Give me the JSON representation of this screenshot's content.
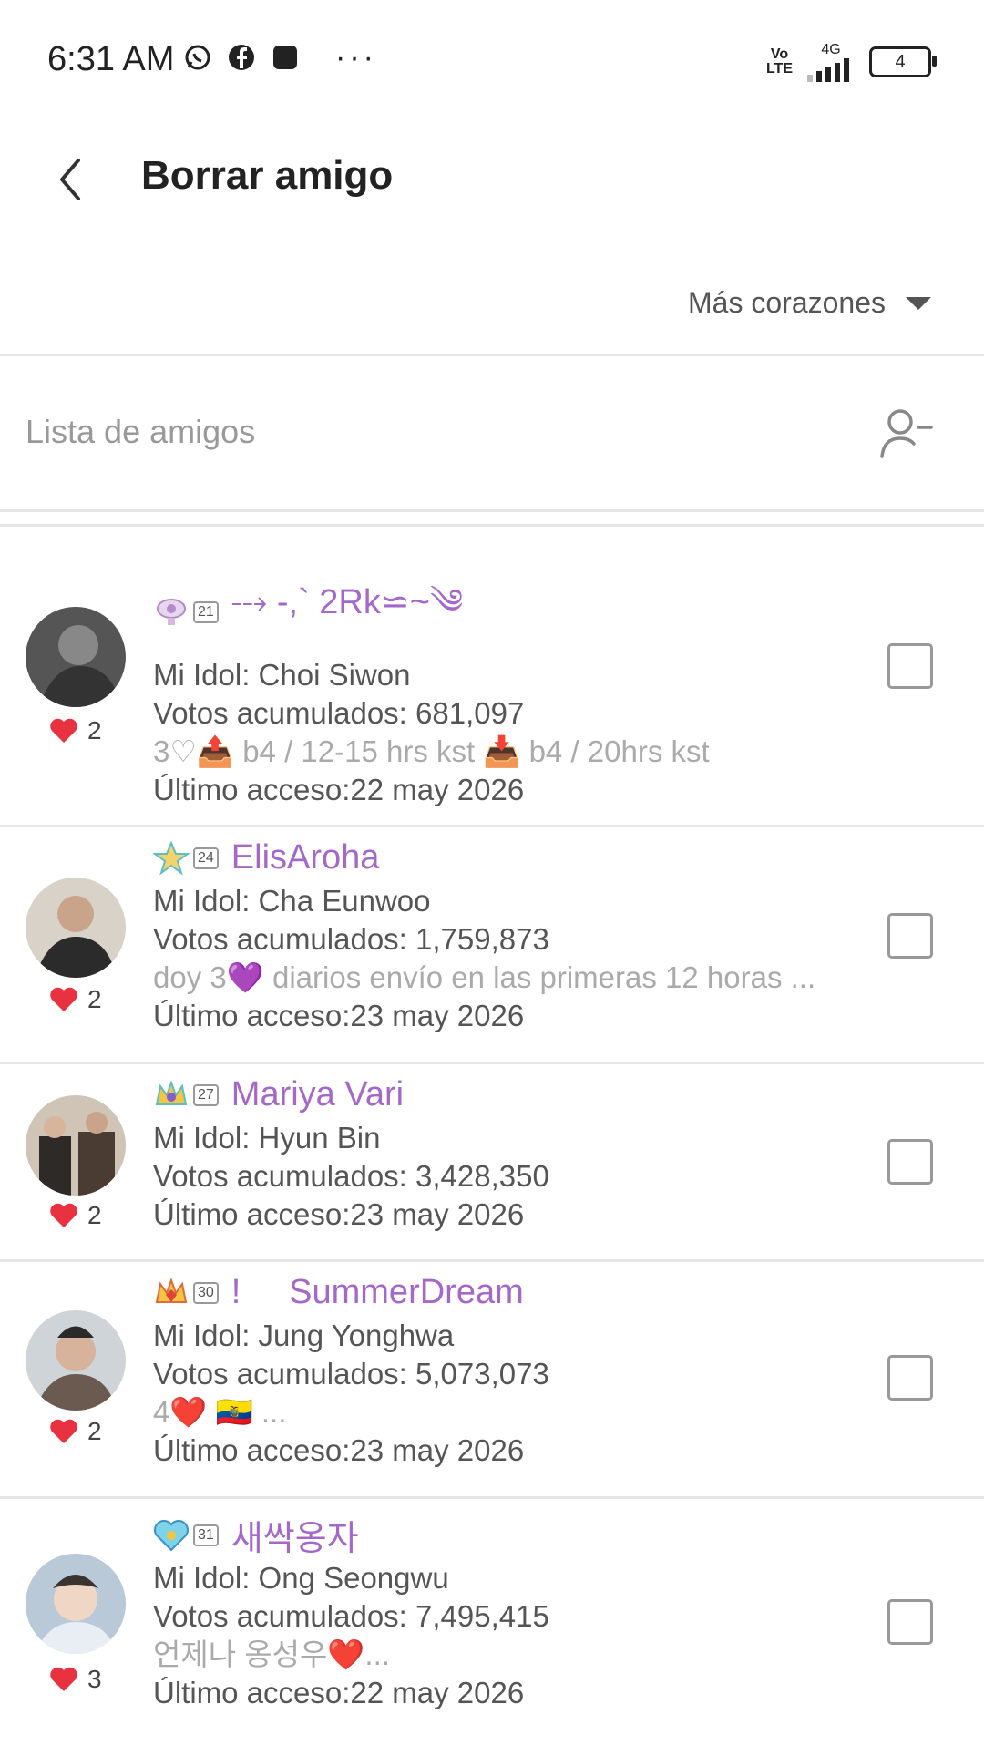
{
  "status_bar": {
    "time": "6:31 AM",
    "network": "4G",
    "volte": "Vo\nLTE",
    "battery": "4"
  },
  "header": {
    "title": "Borrar amigo"
  },
  "sort": {
    "selected": "Más corazones"
  },
  "list": {
    "title": "Lista de amigos"
  },
  "friends": [
    {
      "level": "21",
      "name": "⤏ -,` 2Rk⋍~༄",
      "idol": "Mi Idol: Choi Siwon",
      "votes": "Votos acumulados: 681,097",
      "message": "3♡📤 b4 / 12-15 hrs kst 📥 b4 / 20hrs kst",
      "last_access": "Último acceso:22 may 2026",
      "hearts": "2",
      "avatar_color": "#555"
    },
    {
      "level": "24",
      "name": "ElisAroha",
      "idol": "Mi Idol: Cha Eunwoo",
      "votes": "Votos acumulados: 1,759,873",
      "message": "doy 3💜 diarios  envío en las primeras 12 horas ...",
      "last_access": "Último acceso:23 may 2026",
      "hearts": "2",
      "avatar_color": "#2b2b2b"
    },
    {
      "level": "27",
      "name": "Mariya Vari",
      "idol": "Mi Idol: Hyun Bin",
      "votes": "Votos acumulados: 3,428,350",
      "message": "",
      "last_access": "Último acceso:23 may 2026",
      "hearts": "2",
      "avatar_color": "#4a3b33"
    },
    {
      "level": "30",
      "name": "!     SummerDream",
      "idol": "Mi Idol: Jung Yonghwa",
      "votes": "Votos acumulados: 5,073,073",
      "message": "4❤️ 🇪🇨 ...",
      "last_access": "Último acceso:23 may 2026",
      "hearts": "2",
      "avatar_color": "#6b5a50"
    },
    {
      "level": "31",
      "name": "새싹옹자",
      "idol": "Mi Idol: Ong Seongwu",
      "votes": "Votos acumulados: 7,495,415",
      "message": "언제나 옹성우❤️...",
      "last_access": "Último acceso:22 may 2026",
      "hearts": "3",
      "avatar_color": "#b9c9d8"
    }
  ],
  "colors": {
    "accent": "#a468c8",
    "heart": "#e8323f",
    "divider": "#e6e6e6"
  }
}
